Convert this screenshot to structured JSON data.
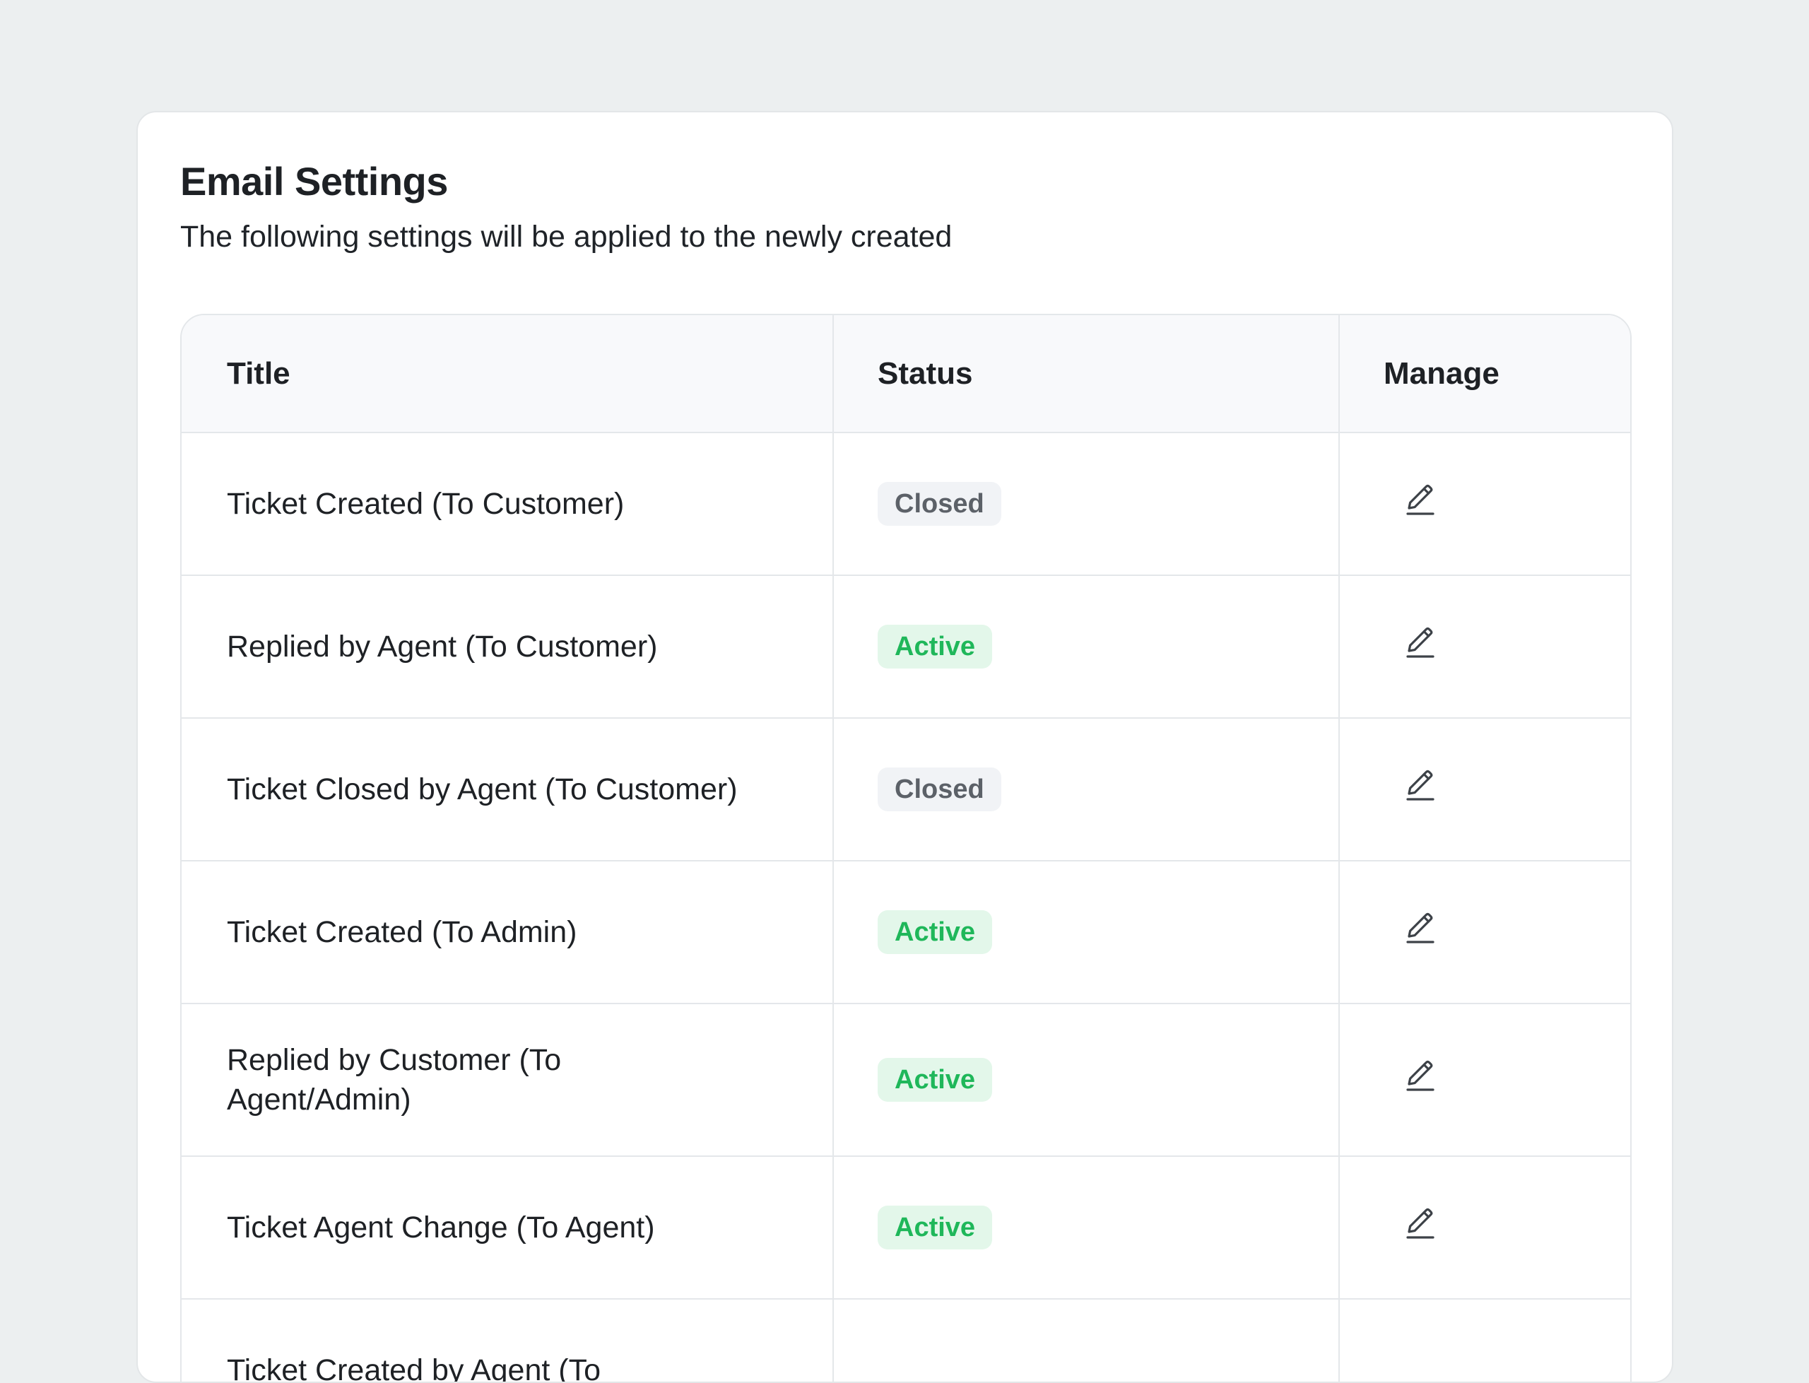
{
  "header": {
    "title": "Email Settings",
    "subtitle": "The following settings will be applied to the newly created"
  },
  "table": {
    "columns": [
      "Title",
      "Status",
      "Manage"
    ],
    "rows": [
      {
        "title": "Ticket Created (To Customer)",
        "status": "Closed"
      },
      {
        "title": "Replied by Agent (To Customer)",
        "status": "Active"
      },
      {
        "title": "Ticket Closed by Agent (To Customer)",
        "status": "Closed"
      },
      {
        "title": "Ticket Created (To Admin)",
        "status": "Active"
      },
      {
        "title": "Replied by Customer (To Agent/Admin)",
        "status": "Active"
      },
      {
        "title": "Ticket Agent Change (To Agent)",
        "status": "Active"
      },
      {
        "title": "Ticket Created by Agent (To",
        "status": ""
      }
    ],
    "manage_icon": "edit-icon"
  },
  "colors": {
    "active_text": "#1fb75a",
    "active_bg": "#e3f7ea",
    "closed_text": "#5c6168",
    "closed_bg": "#f1f3f6",
    "page_bg": "#eceff0"
  }
}
